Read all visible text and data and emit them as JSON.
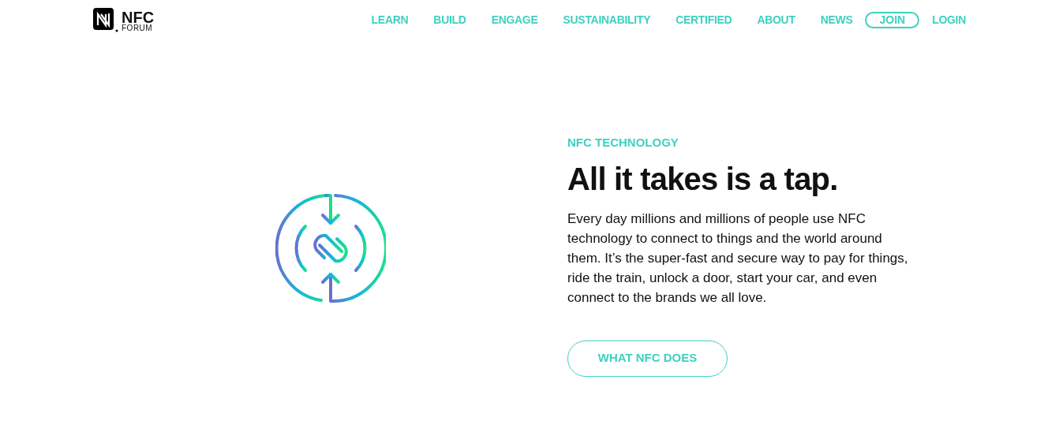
{
  "logo": {
    "name": "NFC",
    "sub": "FORUM"
  },
  "nav": [
    {
      "label": "LEARN",
      "kind": "link"
    },
    {
      "label": "BUILD",
      "kind": "link"
    },
    {
      "label": "ENGAGE",
      "kind": "link"
    },
    {
      "label": "SUSTAINABILITY",
      "kind": "link"
    },
    {
      "label": "CERTIFIED",
      "kind": "link"
    },
    {
      "label": "ABOUT",
      "kind": "link"
    },
    {
      "label": "NEWS",
      "kind": "link"
    },
    {
      "label": "JOIN",
      "kind": "outlined"
    },
    {
      "label": "LOGIN",
      "kind": "link"
    }
  ],
  "hero": {
    "eyebrow": "NFC TECHNOLOGY",
    "title": "All it takes is a tap.",
    "body": "Every day millions and millions of people use NFC technology to connect to things and the world around them. It’s the super-fast and secure way to pay for things, ride the train, unlock a door, start your car, and even connect to the brands we all love.",
    "button": "WHAT NFC DOES"
  }
}
